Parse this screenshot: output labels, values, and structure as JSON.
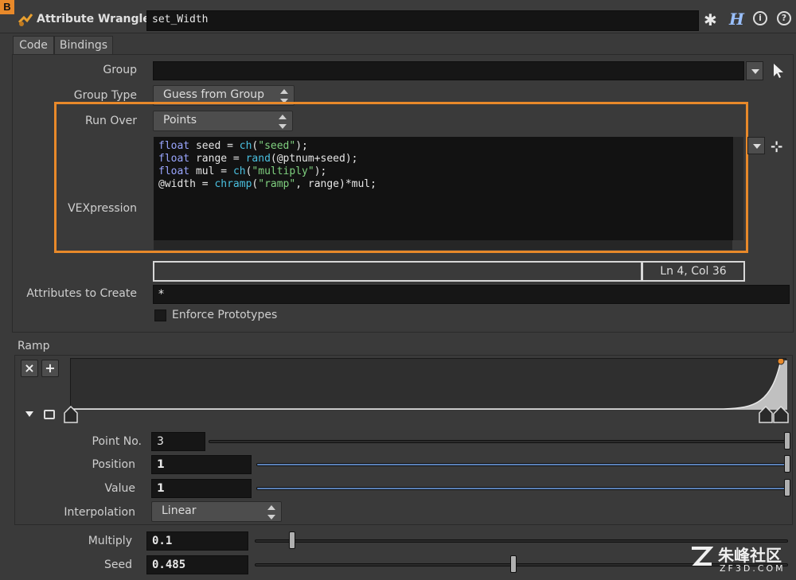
{
  "header": {
    "badge": "B",
    "node_type": "Attribute Wrangle",
    "node_name": "set_Width",
    "icons": [
      "gear-icon",
      "help-h-icon",
      "info-icon",
      "help-icon"
    ]
  },
  "tabs": [
    {
      "label": "Code"
    },
    {
      "label": "Bindings"
    }
  ],
  "params": {
    "group_label": "Group",
    "group_value": "",
    "group_type_label": "Group Type",
    "group_type_value": "Guess from Group",
    "run_over_label": "Run Over",
    "run_over_value": "Points",
    "vex_label": "VEXpression",
    "status": "Ln 4, Col 36",
    "attrs_label": "Attributes to Create",
    "attrs_value": "*",
    "enforce_label": "Enforce Prototypes"
  },
  "vex_code": [
    [
      {
        "t": "float",
        "c": "kw"
      },
      {
        "t": " seed = "
      },
      {
        "t": "ch",
        "c": "fn"
      },
      {
        "t": "("
      },
      {
        "t": "\"seed\"",
        "c": "str"
      },
      {
        "t": ");"
      }
    ],
    [
      {
        "t": "float",
        "c": "kw"
      },
      {
        "t": " range = "
      },
      {
        "t": "rand",
        "c": "fn"
      },
      {
        "t": "(@ptnum+seed);"
      }
    ],
    [
      {
        "t": "float",
        "c": "kw"
      },
      {
        "t": " mul = "
      },
      {
        "t": "ch",
        "c": "fn"
      },
      {
        "t": "("
      },
      {
        "t": "\"multiply\"",
        "c": "str"
      },
      {
        "t": ");"
      }
    ],
    [
      {
        "t": "@width = "
      },
      {
        "t": "chramp",
        "c": "fn"
      },
      {
        "t": "("
      },
      {
        "t": "\"ramp\"",
        "c": "str"
      },
      {
        "t": ", range)*mul;"
      }
    ]
  ],
  "ramp": {
    "label": "Ramp",
    "point_no_label": "Point No.",
    "point_no": "3",
    "position_label": "Position",
    "position": "1",
    "value_label": "Value",
    "value": "1",
    "interp_label": "Interpolation",
    "interp_value": "Linear",
    "close_icon": "×",
    "add_icon": "+"
  },
  "multiply": {
    "label": "Multiply",
    "value": "0.1",
    "fraction": 0.07
  },
  "seed": {
    "label": "Seed",
    "value": "0.485",
    "fraction": 0.485
  },
  "watermark": {
    "brand": "朱峰社区",
    "url": "ZF3D.COM"
  },
  "colors": {
    "highlight": "#e8892a",
    "badge": "#e8892a",
    "slider": "#5a7fb5"
  }
}
